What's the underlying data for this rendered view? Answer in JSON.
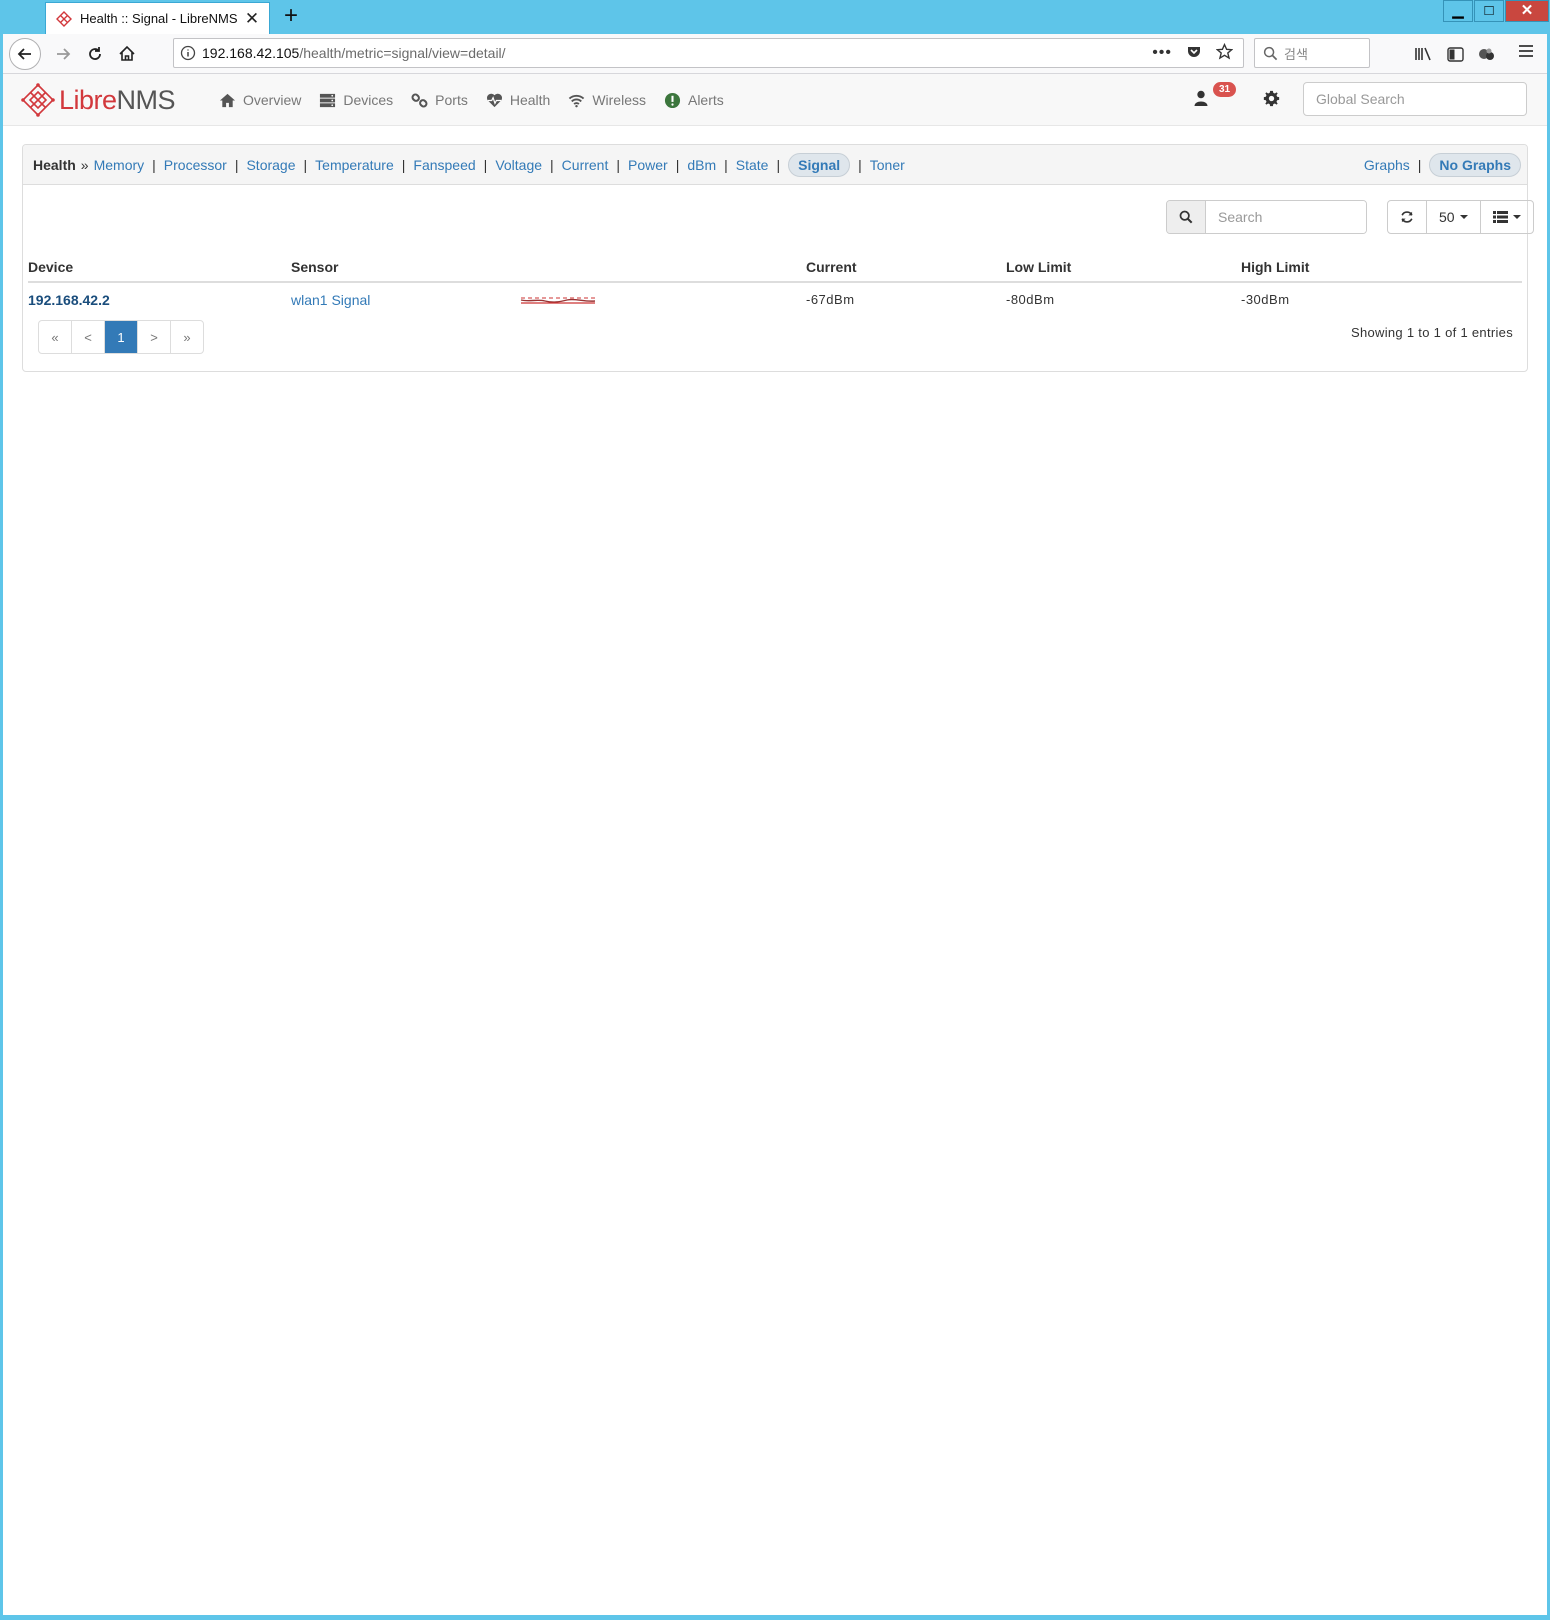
{
  "browser": {
    "tab_title": "Health :: Signal - LibreNMS",
    "url_host": "192.168.42.105",
    "url_path": "/health/metric=signal/view=detail/",
    "search_placeholder": "검색"
  },
  "app": {
    "brand_libre": "Libre",
    "brand_nms": "NMS",
    "menu": [
      {
        "label": "Overview",
        "icon": "home-icon"
      },
      {
        "label": "Devices",
        "icon": "server-icon"
      },
      {
        "label": "Ports",
        "icon": "link-icon"
      },
      {
        "label": "Health",
        "icon": "heartbeat-icon"
      },
      {
        "label": "Wireless",
        "icon": "wifi-icon"
      },
      {
        "label": "Alerts",
        "icon": "exclamation-circle-icon"
      }
    ],
    "notification_count": "31",
    "global_search_placeholder": "Global Search"
  },
  "health": {
    "title": "Health",
    "links": [
      "Memory",
      "Processor",
      "Storage",
      "Temperature",
      "Fanspeed",
      "Voltage",
      "Current",
      "Power",
      "dBm",
      "State",
      "Signal",
      "Toner"
    ],
    "active": "Signal",
    "view_links": [
      "Graphs",
      "No Graphs"
    ],
    "active_view": "No Graphs"
  },
  "table": {
    "search_placeholder": "Search",
    "page_size": "50",
    "headers": {
      "device": "Device",
      "sensor": "Sensor",
      "current": "Current",
      "low": "Low Limit",
      "high": "High Limit"
    },
    "rows": [
      {
        "device": "192.168.42.2",
        "sensor": "wlan1 Signal",
        "current": "-67dBm",
        "low": "-80dBm",
        "high": "-30dBm"
      }
    ],
    "pagination": [
      "«",
      "<",
      "1",
      ">",
      "»"
    ],
    "current_page": "1",
    "showing": "Showing 1 to 1 of 1 entries"
  },
  "colors": {
    "brand_red": "#d2383c",
    "link": "#337ab7",
    "badge": "#d9534f",
    "chrome": "#5ec5e9"
  }
}
